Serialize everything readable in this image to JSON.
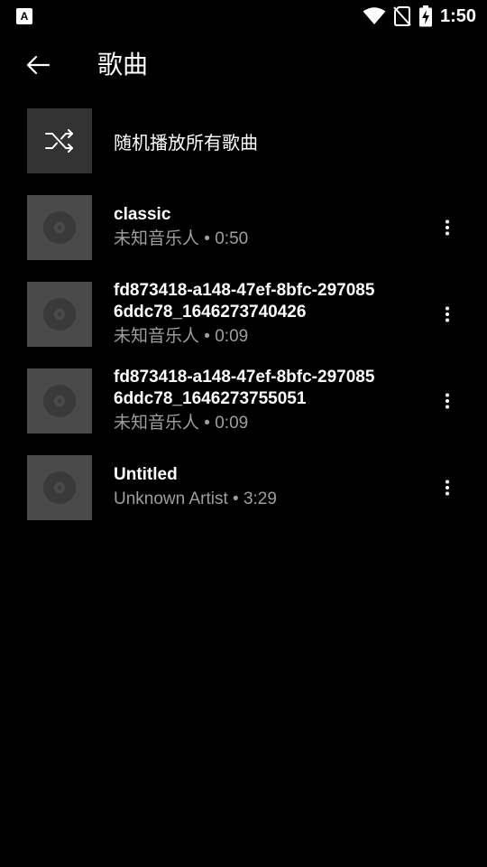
{
  "status_bar": {
    "app_icon_letter": "A",
    "time": "1:50",
    "icons": [
      "wifi-icon",
      "no-sim-icon",
      "battery-charging-icon"
    ]
  },
  "toolbar": {
    "back_icon": "arrow-left-icon",
    "title": "歌曲"
  },
  "shuffle": {
    "icon": "shuffle-icon",
    "label": "随机播放所有歌曲"
  },
  "songs": [
    {
      "title": "classic",
      "artist": "未知音乐人",
      "duration": "0:50"
    },
    {
      "title_line1": "fd873418-a148-47ef-8bfc-297085",
      "title_line2": "6ddc78_1646273740426",
      "artist": "未知音乐人",
      "duration": "0:09"
    },
    {
      "title_line1": "fd873418-a148-47ef-8bfc-297085",
      "title_line2": "6ddc78_1646273755051",
      "artist": "未知音乐人",
      "duration": "0:09"
    },
    {
      "title": "Untitled",
      "artist": "Unknown Artist",
      "duration": "3:29"
    }
  ],
  "separator": " • ",
  "colors": {
    "background": "#000000",
    "album_placeholder": "#4a4a4a",
    "shuffle_tile": "#333333",
    "secondary_text": "#9e9e9e"
  }
}
